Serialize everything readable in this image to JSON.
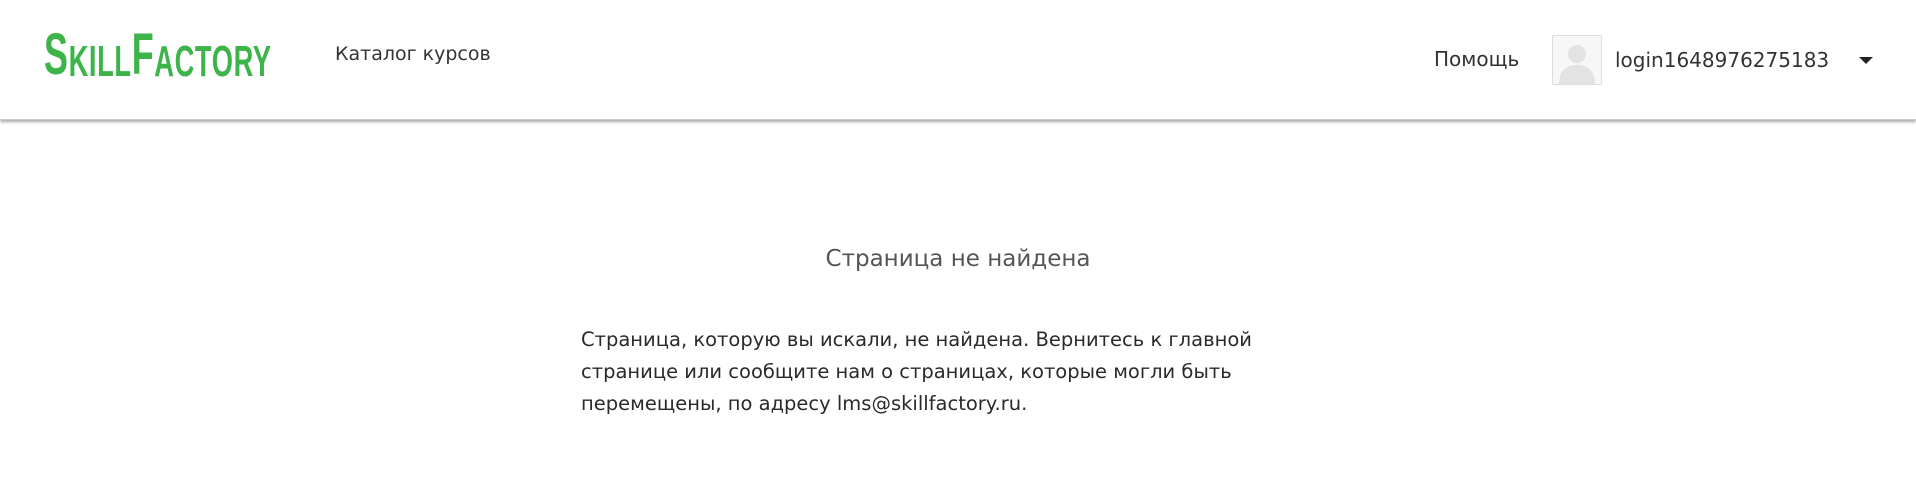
{
  "header": {
    "logo_prefix_big_1": "S",
    "logo_prefix_small_1": "KILL",
    "logo_prefix_big_2": "F",
    "logo_prefix_small_2": "ACTORY",
    "logo_color": "#3cb449",
    "nav": {
      "catalog_label": "Каталог курсов"
    },
    "help_label": "Помощь",
    "user": {
      "username": "login1648976275183",
      "avatar_icon": "user-avatar-placeholder-icon",
      "dropdown_icon": "caret-down-icon"
    }
  },
  "main": {
    "title": "Страница не найдена",
    "message": "Страница, которую вы искали, не найдена. Вернитесь к главной странице или сообщите нам о страницах, которые могли быть перемещены, по адресу lms@skillfactory.ru."
  }
}
